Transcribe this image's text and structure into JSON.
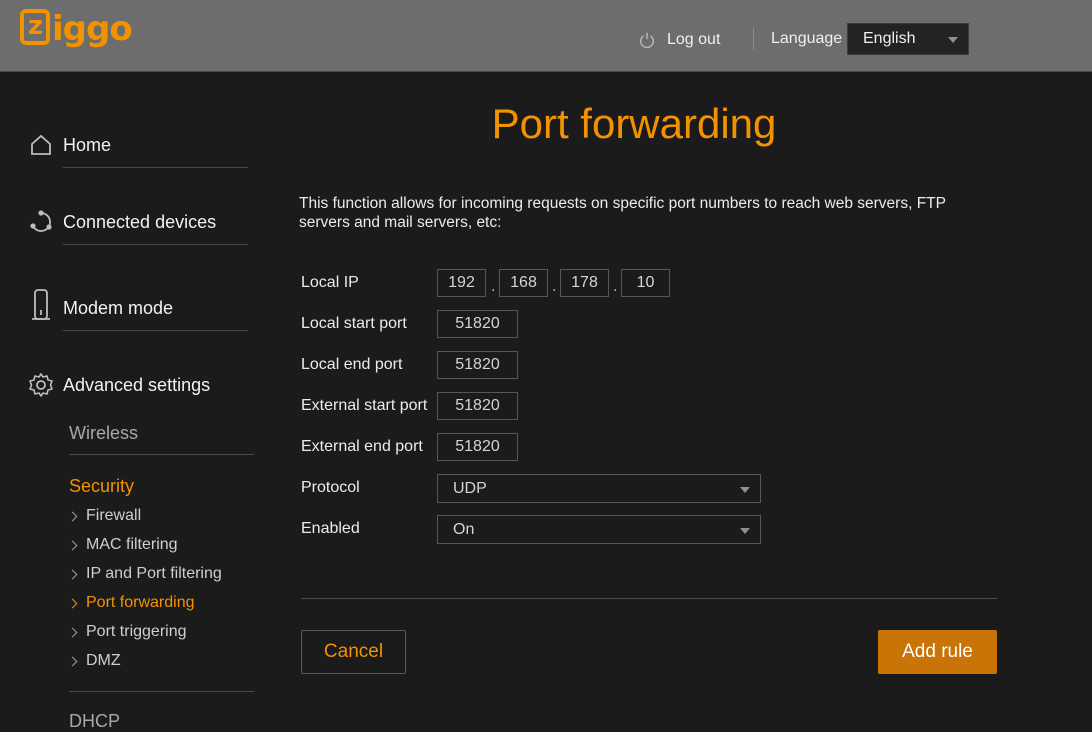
{
  "brand": {
    "logo_text": "ziggo",
    "logo_letter": "z",
    "accent": "#f39200"
  },
  "header": {
    "logout_label": "Log out",
    "language_label": "Language",
    "language_value": "English"
  },
  "sidebar": {
    "items": [
      {
        "label": "Home",
        "icon": "home-icon"
      },
      {
        "label": "Connected devices",
        "icon": "devices-icon"
      },
      {
        "label": "Modem mode",
        "icon": "modem-icon"
      },
      {
        "label": "Advanced settings",
        "icon": "gear-icon"
      }
    ],
    "wireless": "Wireless",
    "security": "Security",
    "security_items": [
      "Firewall",
      "MAC filtering",
      "IP and Port filtering",
      "Port forwarding",
      "Port triggering",
      "DMZ"
    ],
    "active_item": "Port forwarding",
    "next_partial": "DHCP"
  },
  "main": {
    "title": "Port forwarding",
    "description": "This function allows for incoming requests on specific port numbers to reach web servers, FTP servers and mail servers, etc:",
    "labels": {
      "local_ip": "Local IP",
      "local_start": "Local start port",
      "local_end": "Local end port",
      "external_start": "External start port",
      "external_end": "External end port",
      "protocol": "Protocol",
      "enabled": "Enabled"
    },
    "local_ip": [
      "192",
      "168",
      "178",
      "10"
    ],
    "ip_separator": ".",
    "local_start_port": "51820",
    "local_end_port": "51820",
    "external_start_port": "51820",
    "external_end_port": "51820",
    "protocol": "UDP",
    "enabled": "On",
    "cancel_label": "Cancel",
    "add_label": "Add rule"
  }
}
